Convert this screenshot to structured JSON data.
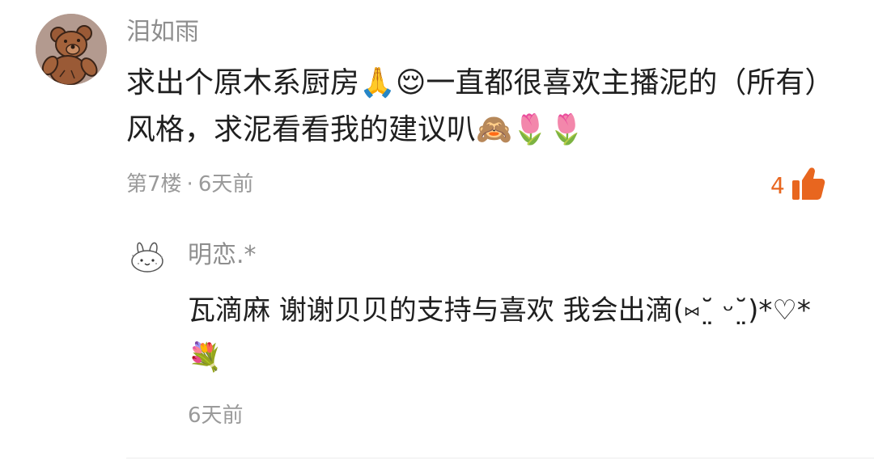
{
  "comment": {
    "username": "泪如雨",
    "text": "求出个原木系厨房🙏😌一直都很喜欢主播泥的（所有）风格，求泥看看我的建议叭🙈🌷🌷",
    "floor": "第7楼",
    "separator": "·",
    "time": "6天前",
    "likes": "4",
    "avatar_icon": "teddy-bear-avatar",
    "like_icon": "thumbs-up-icon"
  },
  "reply": {
    "username": "明恋.*",
    "text": "瓦滴麻 谢谢贝贝的支持与喜欢 我会出滴(⑅˘̤ ᵕ˘̤)*♡*💐",
    "time": "6天前",
    "avatar_icon": "bunny-avatar"
  },
  "colors": {
    "username_gray": "#8e8e8e",
    "meta_gray": "#9a9a9a",
    "text": "#1f1f1f",
    "like_orange": "#e8661f",
    "background": "#ffffff"
  }
}
